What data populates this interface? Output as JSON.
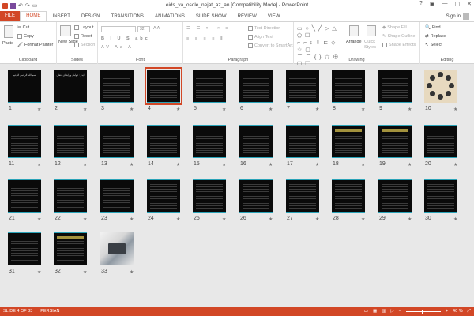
{
  "window": {
    "title": "eids_va_osole_nejat_az_an [Compatibility Mode] - PowerPoint",
    "sign_in": "Sign in",
    "controls": [
      "?",
      "▣",
      "—",
      "▢",
      "✕"
    ]
  },
  "tabs": [
    {
      "label": "FILE"
    },
    {
      "label": "HOME"
    },
    {
      "label": "INSERT"
    },
    {
      "label": "DESIGN"
    },
    {
      "label": "TRANSITIONS"
    },
    {
      "label": "ANIMATIONS"
    },
    {
      "label": "SLIDE SHOW"
    },
    {
      "label": "REVIEW"
    },
    {
      "label": "VIEW"
    }
  ],
  "active_tab": "HOME",
  "ribbon": {
    "clipboard": {
      "label": "Clipboard",
      "paste": "Paste",
      "cut": "Cut",
      "copy": "Copy",
      "format_painter": "Format Painter"
    },
    "slides": {
      "label": "Slides",
      "new_slide": "New Slide",
      "layout": "Layout",
      "reset": "Reset",
      "section": "Section"
    },
    "font": {
      "label": "Font",
      "size": "32"
    },
    "paragraph": {
      "label": "Paragraph",
      "text_direction": "Text Direction",
      "align_text": "Align Text",
      "convert": "Convert to SmartArt"
    },
    "drawing": {
      "label": "Drawing",
      "arrange": "Arrange",
      "quick_styles": "Quick Styles",
      "shape_fill": "Shape Fill",
      "shape_outline": "Shape Outline",
      "shape_effects": "Shape Effects"
    },
    "editing": {
      "label": "Editing",
      "find": "Find",
      "replace": "Replace",
      "select": "Select"
    }
  },
  "slides": {
    "numbers": [
      "1",
      "2",
      "3",
      "4",
      "5",
      "6",
      "7",
      "8",
      "9",
      "10",
      "11",
      "12",
      "13",
      "14",
      "15",
      "16",
      "17",
      "18",
      "19",
      "20",
      "21",
      "22",
      "23",
      "24",
      "25",
      "26",
      "27",
      "28",
      "29",
      "30",
      "31",
      "32",
      "33"
    ],
    "star": "★",
    "selected": "4",
    "title_texts": {
      "1": "بسم الله الرحمن الرحیم",
      "2": "ایدز : عوامل و راههای انتقال"
    }
  },
  "status": {
    "slide_indicator": "SLIDE 4 OF 33",
    "language": "PERSIAN",
    "zoom": "40 %"
  },
  "colors": {
    "accent": "#d24726",
    "slide_bg": "#0a0a0a",
    "slide_border": "#2aa3b8"
  }
}
